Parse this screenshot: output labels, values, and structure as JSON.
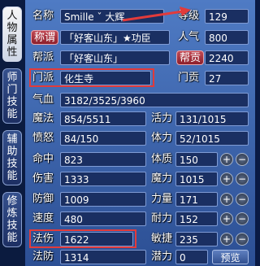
{
  "tabs": [
    "人物属性",
    "师门技能",
    "辅助技能",
    "修炼技能"
  ],
  "profile": {
    "name_label": "名称",
    "name_value": "Smille ˇ 大辉",
    "level_label": "等级",
    "level_value": "129",
    "title_button": "称谓",
    "title_value": "「好客山东」★功臣",
    "popularity_label": "人气",
    "popularity_value": "800",
    "faction_label": "帮派",
    "faction_value": "「好客山东」",
    "contribution_button": "帮贡",
    "contribution_value": "2240",
    "sect_label": "门派",
    "sect_value": "化生寺",
    "sect_contribution_label": "门贡",
    "sect_contribution_value": "27"
  },
  "stats": {
    "hp_label": "气血",
    "hp_value": "3182/3525/3960",
    "mp_label": "魔法",
    "mp_value": "854/5511",
    "vitality_label": "活力",
    "vitality_value": "131/1015",
    "anger_label": "愤怒",
    "anger_value": "84/150",
    "stamina_label": "体力",
    "stamina_value": "52/1015",
    "hit_label": "命中",
    "hit_value": "823",
    "constitution_label": "体质",
    "constitution_value": "150",
    "damage_label": "伤害",
    "damage_value": "1333",
    "magic_label": "魔力",
    "magic_value": "1015",
    "defense_label": "防御",
    "defense_value": "1009",
    "strength_label": "力量",
    "strength_value": "171",
    "speed_label": "速度",
    "speed_value": "480",
    "endurance_label": "耐力",
    "endurance_value": "152",
    "spell_damage_label": "法伤",
    "spell_damage_value": "1622",
    "agility_label": "敏捷",
    "agility_value": "235",
    "spell_defense_label": "法防",
    "spell_defense_value": "1314",
    "potential_label": "潜力",
    "potential_value": "0",
    "preview_button": "预览"
  },
  "controls": {
    "plus": "+",
    "minus": "−"
  },
  "colors": {
    "highlight": "#e23b3b",
    "panel": "#3b63ab"
  }
}
